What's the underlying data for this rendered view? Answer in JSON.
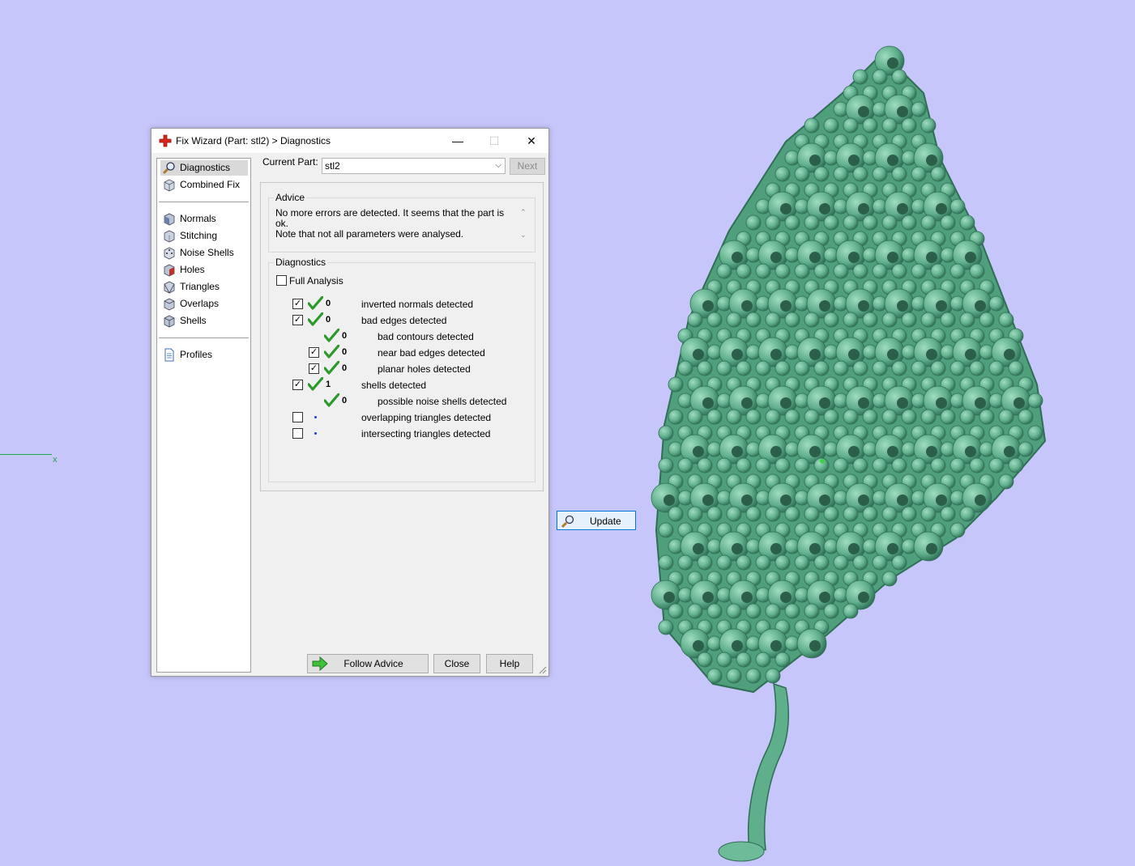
{
  "viewport": {
    "axis_label": "x",
    "background": "#c6c6fa",
    "model_color": "#5fae8c"
  },
  "window": {
    "title": "Fix Wizard (Part: stl2) > Diagnostics",
    "icon": "red-cross-icon",
    "minimize": "—",
    "maximize": "☐",
    "close": "✕"
  },
  "sidebar": {
    "groups": [
      [
        {
          "label": "Diagnostics",
          "icon": "magnifier-icon",
          "selected": true
        },
        {
          "label": "Combined Fix",
          "icon": "cube-icon"
        }
      ],
      [
        {
          "label": "Normals",
          "icon": "normals-cube-icon"
        },
        {
          "label": "Stitching",
          "icon": "stitching-cube-icon"
        },
        {
          "label": "Noise Shells",
          "icon": "dice-icon"
        },
        {
          "label": "Holes",
          "icon": "holes-cube-icon"
        },
        {
          "label": "Triangles",
          "icon": "triangles-cube-icon"
        },
        {
          "label": "Overlaps",
          "icon": "overlaps-cube-icon"
        },
        {
          "label": "Shells",
          "icon": "shells-cube-icon"
        }
      ],
      [
        {
          "label": "Profiles",
          "icon": "document-icon"
        }
      ]
    ]
  },
  "header": {
    "current_part_label": "Current Part:",
    "current_part_value": "stl2",
    "next_label": "Next"
  },
  "advice": {
    "title": "Advice",
    "line1": "No more errors are detected. It seems that the part is ok.",
    "line2": "Note that not all parameters were analysed."
  },
  "diagnostics": {
    "title": "Diagnostics",
    "full_analysis_label": "Full Analysis",
    "full_analysis_checked": false,
    "rows": [
      {
        "checkbox": true,
        "checked": true,
        "status": "ok",
        "count": "0",
        "label": "inverted normals detected",
        "indent": 0
      },
      {
        "checkbox": true,
        "checked": true,
        "status": "ok",
        "count": "0",
        "label": "bad edges detected",
        "indent": 0
      },
      {
        "checkbox": false,
        "checked": false,
        "status": "ok",
        "count": "0",
        "label": "bad contours detected",
        "indent": 1
      },
      {
        "checkbox": true,
        "checked": true,
        "status": "ok",
        "count": "0",
        "label": "near bad edges detected",
        "indent": 1
      },
      {
        "checkbox": true,
        "checked": true,
        "status": "ok",
        "count": "0",
        "label": "planar holes detected",
        "indent": 1
      },
      {
        "checkbox": true,
        "checked": true,
        "status": "ok",
        "count": "1",
        "label": "shells detected",
        "indent": 0
      },
      {
        "checkbox": false,
        "checked": false,
        "status": "ok",
        "count": "0",
        "label": "possible noise shells detected",
        "indent": 1
      },
      {
        "checkbox": true,
        "checked": false,
        "status": "not-run",
        "count": "",
        "label": "overlapping triangles detected",
        "indent": 0
      },
      {
        "checkbox": true,
        "checked": false,
        "status": "not-run",
        "count": "",
        "label": "intersecting triangles detected",
        "indent": 0
      }
    ],
    "update_label": "Update"
  },
  "footer": {
    "follow_advice_label": "Follow Advice",
    "close_label": "Close",
    "help_label": "Help"
  }
}
